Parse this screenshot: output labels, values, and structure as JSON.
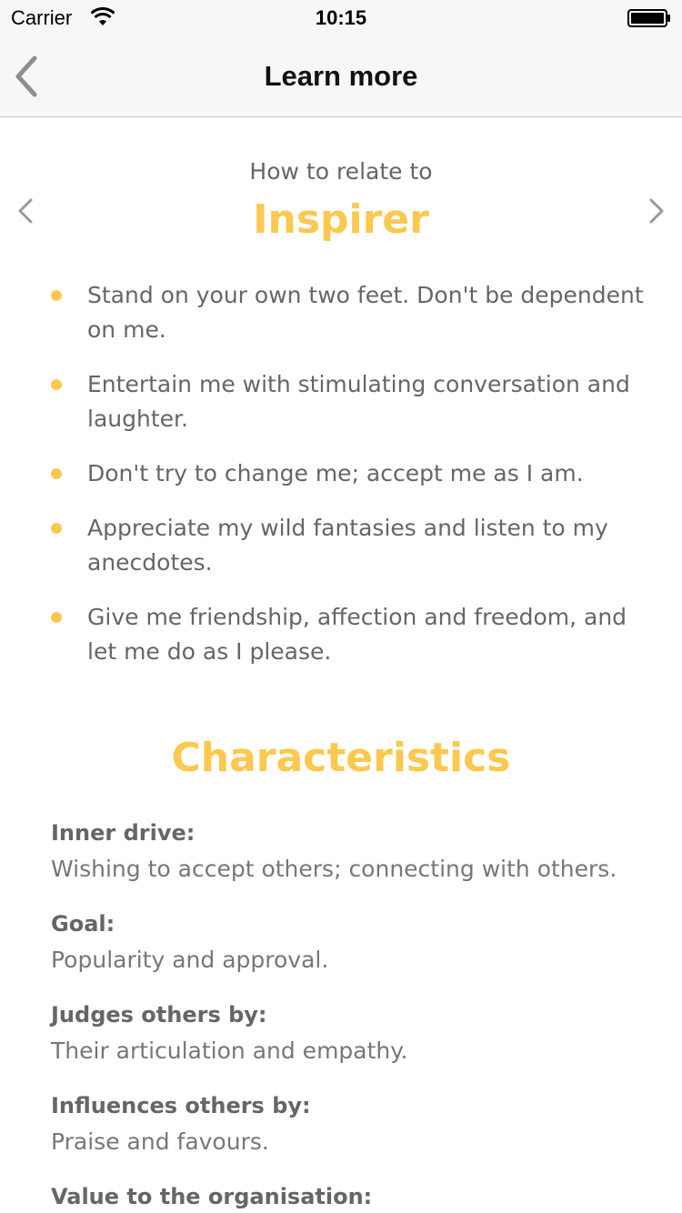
{
  "status_bar": {
    "carrier": "Carrier",
    "time": "10:15"
  },
  "nav": {
    "title": "Learn more",
    "back_icon": "chevron-left-icon"
  },
  "header": {
    "subtitle": "How to relate to",
    "type_name": "Inspirer",
    "accent_color": "#fcc84f"
  },
  "bullets": [
    "Stand on your own two feet. Don't be dependent on me.",
    "Entertain me with stimulating conversation and laughter.",
    "Don't try to change me; accept me as I am.",
    "Appreciate my wild fantasies and listen to my anecdotes.",
    "Give me friendship, affection and freedom, and let me do as I please."
  ],
  "characteristics": {
    "heading": "Characteristics",
    "items": [
      {
        "label": "Inner drive:",
        "value": "Wishing to accept others; connecting with others."
      },
      {
        "label": "Goal:",
        "value": "Popularity and approval."
      },
      {
        "label": "Judges others by:",
        "value": "Their articulation and empathy."
      },
      {
        "label": "Influences others by:",
        "value": "Praise and favours."
      },
      {
        "label": "Value to the organisation:",
        "value": ""
      }
    ]
  }
}
